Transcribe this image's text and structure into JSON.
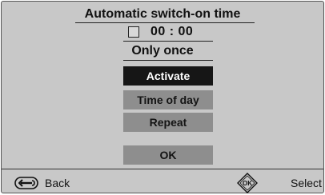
{
  "dialog": {
    "title": "Automatic switch-on time",
    "time": "00 : 00",
    "mode": "Only once"
  },
  "menu": {
    "items": [
      {
        "label": "Activate",
        "state": "selected"
      },
      {
        "label": "Time of day",
        "state": "normal"
      },
      {
        "label": "Repeat",
        "state": "normal"
      },
      {
        "label": "OK",
        "state": "normal"
      }
    ]
  },
  "footer": {
    "back_label": "Back",
    "back_icon": "back-arrow-icon",
    "ok_icon_label": "OK",
    "select_label": "Select"
  },
  "colors": {
    "background": "#c8c8c8",
    "selected_bg": "#161616",
    "button_bg": "#8e8e8e"
  }
}
